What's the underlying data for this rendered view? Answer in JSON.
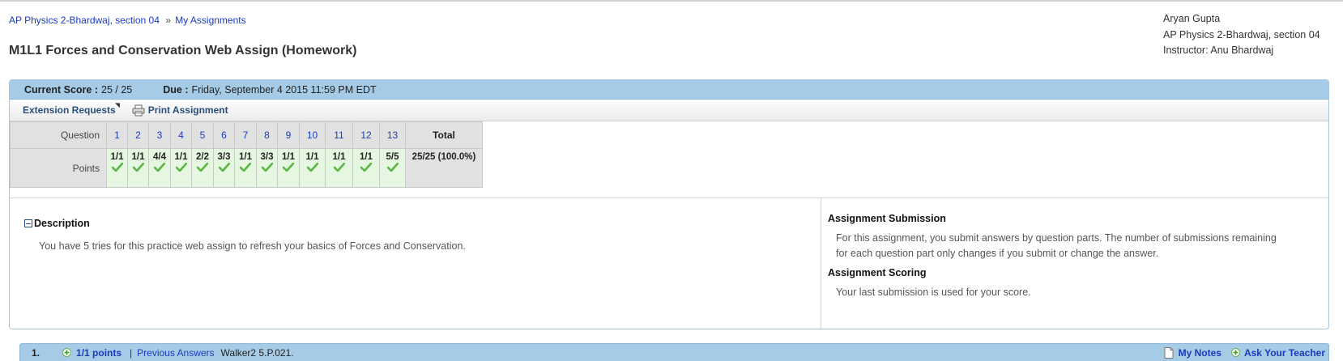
{
  "breadcrumb": {
    "course": "AP Physics 2-Bhardwaj, section 04",
    "separator": "»",
    "assignments": "My Assignments"
  },
  "page_title": "M1L1 Forces and Conservation Web Assign (Homework)",
  "user": {
    "name": "Aryan Gupta",
    "course": "AP Physics 2-Bhardwaj, section 04",
    "instructor": "Instructor: Anu Bhardwaj"
  },
  "score_bar": {
    "score_label": "Current Score :",
    "score_value": "25 / 25",
    "due_label": "Due :",
    "due_value": "Friday, September 4 2015 11:59 PM EDT"
  },
  "toolbar": {
    "extension_requests": "Extension Requests",
    "print_assignment": "Print Assignment"
  },
  "score_table": {
    "question_label": "Question",
    "points_label": "Points",
    "total_label": "Total",
    "total_value": "25/25 (100.0%)",
    "questions": [
      {
        "num": "1",
        "points": "1/1"
      },
      {
        "num": "2",
        "points": "1/1"
      },
      {
        "num": "3",
        "points": "4/4"
      },
      {
        "num": "4",
        "points": "1/1"
      },
      {
        "num": "5",
        "points": "2/2"
      },
      {
        "num": "6",
        "points": "3/3"
      },
      {
        "num": "7",
        "points": "1/1"
      },
      {
        "num": "8",
        "points": "3/3"
      },
      {
        "num": "9",
        "points": "1/1"
      },
      {
        "num": "10",
        "points": "1/1"
      },
      {
        "num": "11",
        "points": "1/1"
      },
      {
        "num": "12",
        "points": "1/1"
      },
      {
        "num": "13",
        "points": "5/5"
      }
    ]
  },
  "description": {
    "heading": "Description",
    "text": "You have 5 tries for this practice web assign to refresh your basics of Forces and Conservation."
  },
  "submission": {
    "heading": "Assignment Submission",
    "text": "For this assignment, you submit answers by question parts. The number of submissions remaining for each question part only changes if you submit or change the answer.",
    "scoring_heading": "Assignment Scoring",
    "scoring_text": "Your last submission is used for your score."
  },
  "question_bar": {
    "number": "1.",
    "points": "1/1 points",
    "separator": "|",
    "previous_answers": "Previous Answers",
    "source": "Walker2 5.P.021.",
    "my_notes": "My Notes",
    "ask_teacher": "Ask Your Teacher"
  },
  "colors": {
    "header_blue": "#a6cbe6",
    "link": "#1a3bbd",
    "correct_bg": "#e6f7e1",
    "check_green": "#5cb544"
  }
}
